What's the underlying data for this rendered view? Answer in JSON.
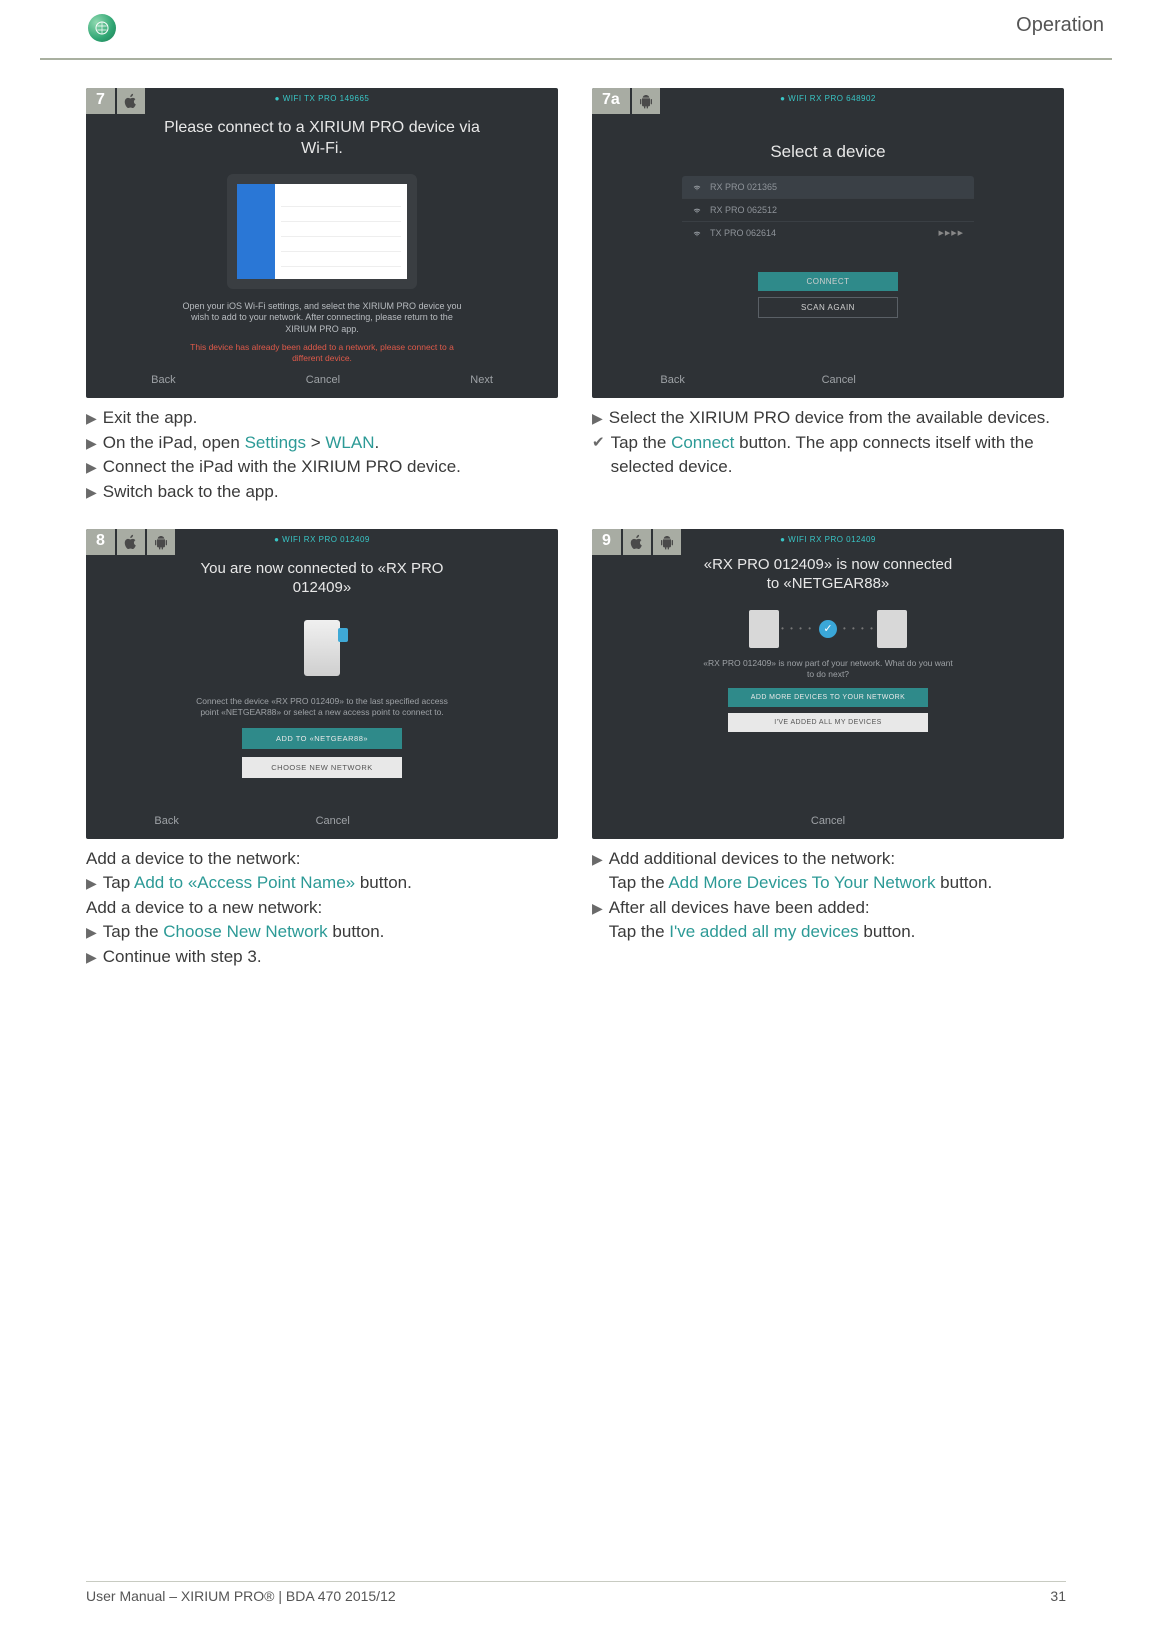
{
  "header": {
    "section": "Operation"
  },
  "step7": {
    "num": "7",
    "status_bar": "● WIFI  TX PRO 149665",
    "title": "Please connect to a XIRIUM PRO device via Wi-Fi.",
    "info": "Open your iOS Wi-Fi settings, and select the XIRIUM PRO device you wish to add to your network. After connecting, please return to the XIRIUM PRO app.",
    "warn": "This device has already been added to a network, please connect to a different device.",
    "back": "Back",
    "cancel": "Cancel",
    "next": "Next",
    "instr": {
      "l1": "Exit the app.",
      "l2a": "On the iPad, open ",
      "l2b": "Settings",
      "l2c": " > ",
      "l2d": "WLAN",
      "l2e": ".",
      "l3": "Connect the iPad with the XIRIUM PRO device.",
      "l4": "Switch back to the app."
    }
  },
  "step7a": {
    "num": "7a",
    "status_bar": "● WIFI  RX PRO 648902",
    "title": "Select a device",
    "devices": {
      "d1": "RX PRO 021365",
      "d2": "RX PRO 062512",
      "d3": "TX PRO 062614",
      "arrow": "▶▶▶▶"
    },
    "connect": "CONNECT",
    "scan": "SCAN AGAIN",
    "back": "Back",
    "cancel": "Cancel",
    "instr": {
      "l1": "Select the XIRIUM PRO device from the available devices.",
      "l2a": "Tap the ",
      "l2b": "Connect",
      "l2c": " button. The app connects itself with the selected device."
    }
  },
  "step8": {
    "num": "8",
    "status_bar": "● WIFI  RX PRO 012409",
    "title": "You are now connected to «RX PRO 012409»",
    "info": "Connect the device «RX PRO 012409» to the last specified access point «NETGEAR88» or select a new access point to connect to.",
    "btn1": "ADD TO «NETGEAR88»",
    "btn2": "CHOOSE NEW NETWORK",
    "back": "Back",
    "cancel": "Cancel",
    "instr": {
      "h1": "Add a device to the network:",
      "l1a": "Tap ",
      "l1b": "Add to «Access Point Name»",
      "l1c": " button.",
      "h2": "Add a device to a new network:",
      "l2a": "Tap the ",
      "l2b": "Choose New Network",
      "l2c": " button.",
      "l3": "Continue with step 3."
    }
  },
  "step9": {
    "num": "9",
    "status_bar": "● WIFI  RX PRO 012409",
    "title": "«RX PRO 012409» is now connected to «NETGEAR88»",
    "info": "«RX PRO 012409» is now part of your network. What do you want to do next?",
    "btn1": "ADD MORE DEVICES TO YOUR NETWORK",
    "btn2": "I'VE ADDED ALL MY DEVICES",
    "cancel": "Cancel",
    "instr": {
      "l1": "Add additional devices to the network:",
      "l1b_a": "Tap the ",
      "l1b_b": "Add More Devices To Your Network",
      "l1b_c": " button.",
      "l2": "After all devices have been added:",
      "l2b_a": "Tap the ",
      "l2b_b": "I've added all my devices",
      "l2b_c": " button."
    }
  },
  "footer": {
    "left": "User Manual – XIRIUM PRO® | BDA 470 2015/12",
    "right": "31"
  }
}
